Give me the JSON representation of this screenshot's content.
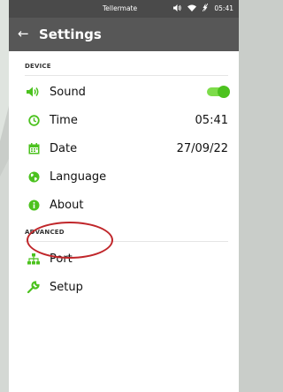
{
  "colors": {
    "accent_green": "#4cc21f",
    "appbar": "#575757",
    "highlight_red": "#c0262a"
  },
  "statusbar": {
    "carrier": "Tellermate",
    "time": "05:41",
    "icons": [
      "volume-icon",
      "wifi-icon",
      "no-charge-icon"
    ]
  },
  "appbar": {
    "back_icon": "arrow-left-icon",
    "title": "Settings"
  },
  "sections": {
    "device": {
      "header": "DEVICE"
    },
    "advanced": {
      "header": "ADVANCED"
    }
  },
  "items": {
    "sound": {
      "label": "Sound",
      "icon": "volume-icon",
      "toggle_on": true
    },
    "time": {
      "label": "Time",
      "value": "05:41",
      "icon": "clock-icon"
    },
    "date": {
      "label": "Date",
      "value": "27/09/22",
      "icon": "calendar-icon"
    },
    "language": {
      "label": "Language",
      "icon": "globe-icon"
    },
    "about": {
      "label": "About",
      "icon": "info-icon"
    },
    "port": {
      "label": "Port",
      "icon": "network-icon"
    },
    "setup": {
      "label": "Setup",
      "icon": "wrench-icon"
    }
  }
}
